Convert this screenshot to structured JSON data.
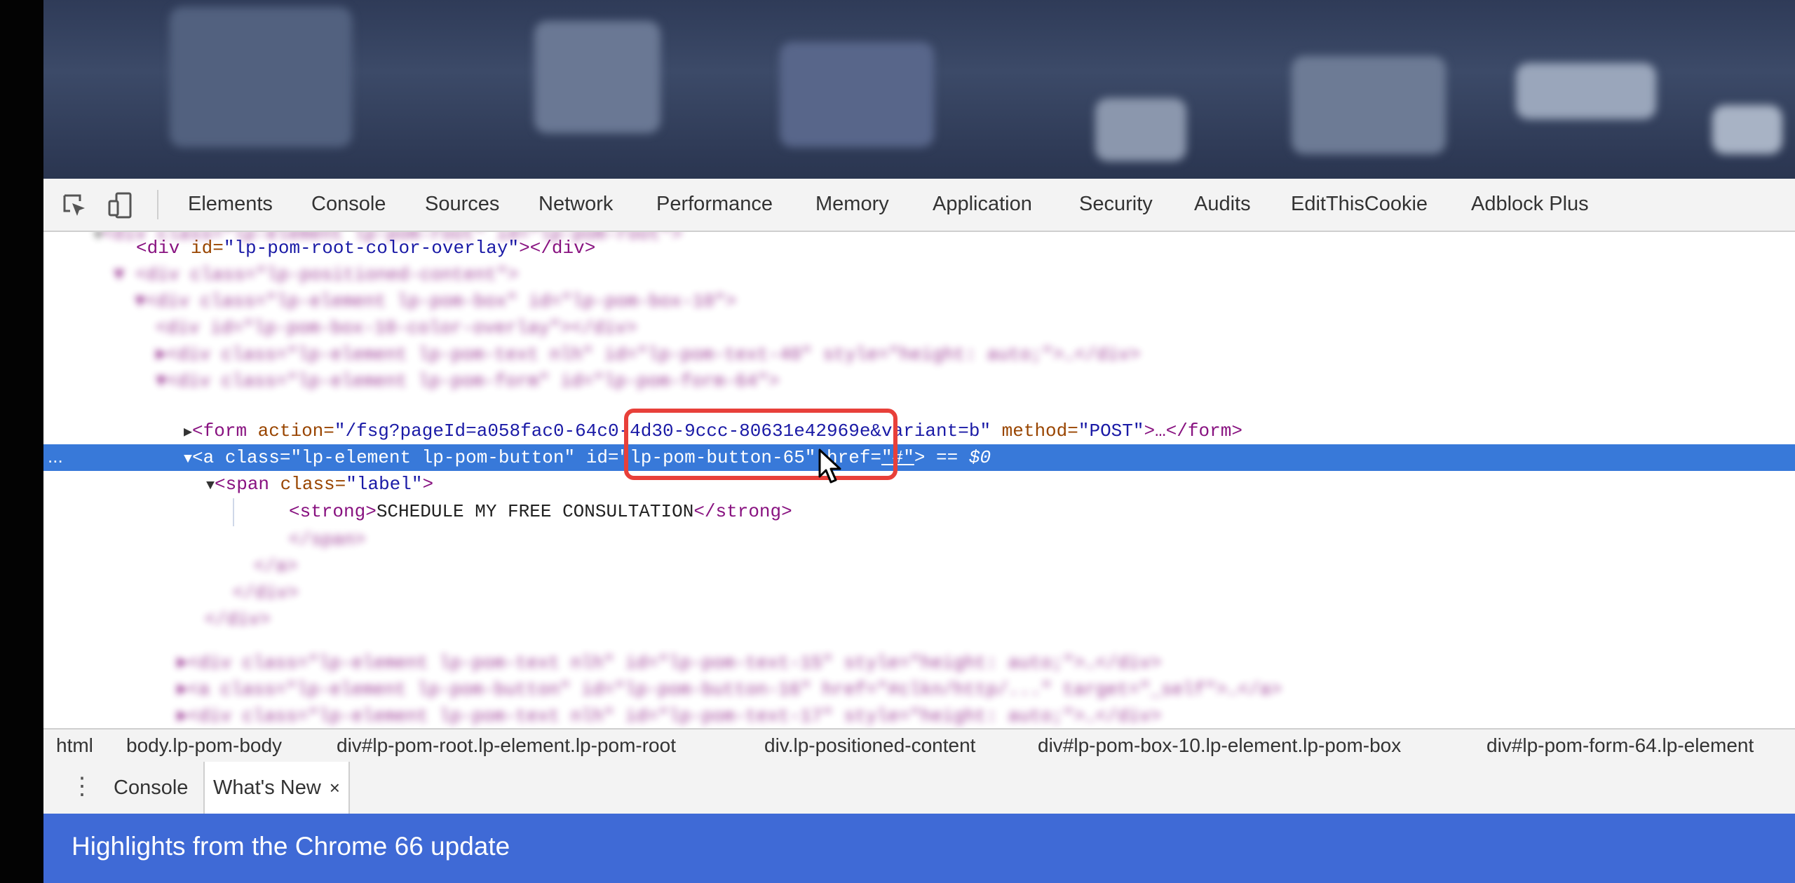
{
  "devtools": {
    "tabs": [
      "Elements",
      "Console",
      "Sources",
      "Network",
      "Performance",
      "Memory",
      "Application",
      "Security",
      "Audits",
      "EditThisCookie",
      "Adblock Plus"
    ],
    "icons": {
      "inspect": "inspect-element-icon",
      "device": "device-toolbar-icon"
    }
  },
  "tree": {
    "line_top": "<div class=\"lp-element lp-pom-root\" id=\"lp-pom-root\">",
    "overlay": {
      "tag_open": "<div ",
      "attr": "id=",
      "val": "\"lp-pom-root-color-overlay\"",
      "tag_close": "></div>"
    },
    "form": {
      "tag_open": "<form ",
      "attr1": "action=",
      "val1": "\"/fsg?pageId=a058fac0-64c0-4d30-9ccc-80631e42969e&variant=b\"",
      "attr2": " method=",
      "val2": "\"POST\"",
      "tag_close": ">…</form>"
    },
    "selected": {
      "dots": "...",
      "tag_open": "<a ",
      "attr1": "class=",
      "val1": "\"lp-element lp-pom-button\"",
      "attr2": " id=",
      "val2": "\"lp-pom-button-65\"",
      "attr3": " href=",
      "val3": "\"#\"",
      "tag_close": ">",
      "suffix": " == $0"
    },
    "span": {
      "tag_open": "<span ",
      "attr": "class=",
      "val": "\"label\"",
      "tag_close": ">"
    },
    "strong": {
      "open": "<strong>",
      "text": "SCHEDULE MY FREE CONSULTATION",
      "close": "</strong>"
    }
  },
  "breadcrumb": [
    "html",
    "body.lp-pom-body",
    "div#lp-pom-root.lp-element.lp-pom-root",
    "div.lp-positioned-content",
    "div#lp-pom-box-10.lp-element.lp-pom-box",
    "div#lp-pom-form-64.lp-element"
  ],
  "drawer": {
    "tabs": [
      "Console",
      "What's New"
    ],
    "close": "×"
  },
  "banner": {
    "text": "Highlights from the Chrome 66 update"
  }
}
